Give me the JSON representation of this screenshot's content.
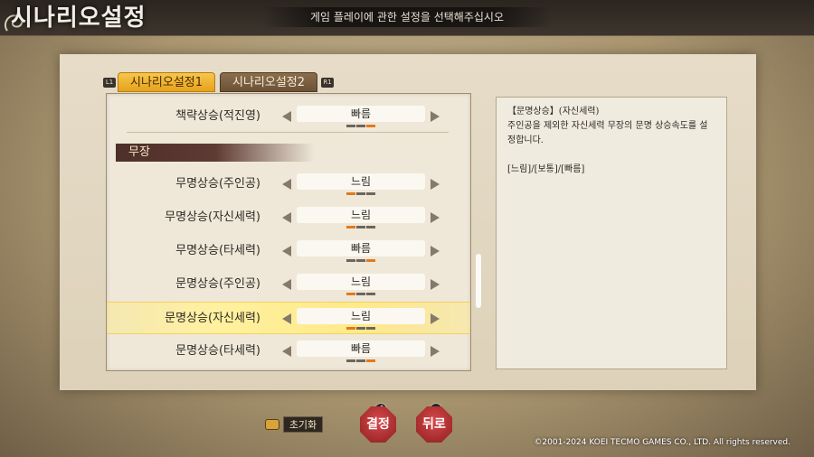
{
  "header": {
    "title": "시나리오설정",
    "description": "게임 플레이에 관한 설정을 선택해주십시오"
  },
  "tabs": {
    "left_hint": "L1",
    "right_hint": "R1",
    "items": [
      {
        "label": "시나리오설정1",
        "active": true
      },
      {
        "label": "시나리오설정2",
        "active": false
      }
    ]
  },
  "settings": {
    "top_row": {
      "label": "책략상승(적진영)",
      "value": "빠름",
      "level": 3
    },
    "section_title": "무장",
    "rows": [
      {
        "label": "무명상승(주인공)",
        "value": "느림",
        "level": 1,
        "selected": false
      },
      {
        "label": "무명상승(자신세력)",
        "value": "느림",
        "level": 1,
        "selected": false
      },
      {
        "label": "무명상승(타세력)",
        "value": "빠름",
        "level": 3,
        "selected": false
      },
      {
        "label": "문명상승(주인공)",
        "value": "느림",
        "level": 1,
        "selected": false
      },
      {
        "label": "문명상승(자신세력)",
        "value": "느림",
        "level": 1,
        "selected": true
      },
      {
        "label": "문명상승(타세력)",
        "value": "빠름",
        "level": 3,
        "selected": false
      }
    ],
    "levels_max": 3
  },
  "description": {
    "title": "【문명상승】(자신세력)",
    "body": "주인공을 제외한 자신세력 무장의 문명 상승속도를 설정합니다.",
    "options": "[느림]/[보통]/[빠름]"
  },
  "footer": {
    "reset_label": "초기화",
    "confirm_label": "결정",
    "back_label": "뒤로",
    "copyright": "©2001-2024 KOEI TECMO GAMES CO., LTD. All rights reserved."
  },
  "colors": {
    "tab_active": "#f0b43a",
    "highlight": "#ffe98a",
    "pip_on": "#e07a1f",
    "button_red": "#b8303a"
  }
}
